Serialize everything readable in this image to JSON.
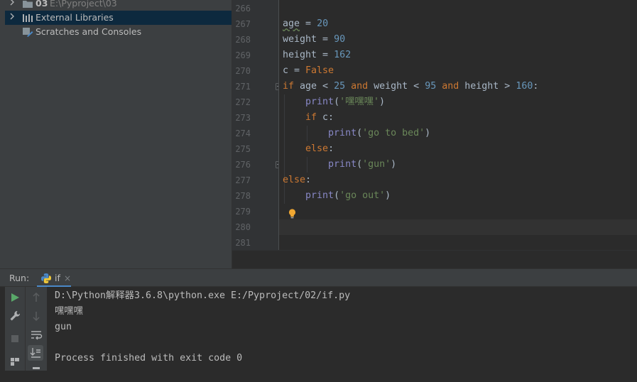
{
  "project_tree": {
    "items": [
      {
        "name": "03",
        "path": "E:\\Pyproject\\03"
      },
      {
        "label": "External Libraries"
      },
      {
        "label": "Scratches and Consoles"
      }
    ]
  },
  "editor": {
    "line_numbers": [
      "266",
      "267",
      "268",
      "269",
      "270",
      "271",
      "272",
      "273",
      "274",
      "275",
      "276",
      "277",
      "278",
      "279",
      "280",
      "281"
    ],
    "lines": [
      [],
      [
        {
          "t": "age",
          "c": "var wavy"
        },
        {
          "t": " = ",
          "c": ""
        },
        {
          "t": "20",
          "c": "num"
        }
      ],
      [
        {
          "t": "weight = ",
          "c": ""
        },
        {
          "t": "90",
          "c": "num"
        }
      ],
      [
        {
          "t": "height = ",
          "c": ""
        },
        {
          "t": "162",
          "c": "num"
        }
      ],
      [
        {
          "t": "c = ",
          "c": ""
        },
        {
          "t": "False",
          "c": "kw"
        }
      ],
      [
        {
          "t": "if",
          "c": "kw"
        },
        {
          "t": " age < ",
          "c": ""
        },
        {
          "t": "25",
          "c": "num"
        },
        {
          "t": " ",
          "c": ""
        },
        {
          "t": "and",
          "c": "kw"
        },
        {
          "t": " weight < ",
          "c": ""
        },
        {
          "t": "95",
          "c": "num"
        },
        {
          "t": " ",
          "c": ""
        },
        {
          "t": "and",
          "c": "kw"
        },
        {
          "t": " height > ",
          "c": ""
        },
        {
          "t": "160",
          "c": "num"
        },
        {
          "t": ":",
          "c": ""
        }
      ],
      [
        {
          "t": "    ",
          "c": ""
        },
        {
          "t": "print",
          "c": "fn"
        },
        {
          "t": "(",
          "c": ""
        },
        {
          "t": "'嘿嘿嘿'",
          "c": "str"
        },
        {
          "t": ")",
          "c": ""
        }
      ],
      [
        {
          "t": "    ",
          "c": ""
        },
        {
          "t": "if",
          "c": "kw"
        },
        {
          "t": " c:",
          "c": ""
        }
      ],
      [
        {
          "t": "        ",
          "c": ""
        },
        {
          "t": "print",
          "c": "fn"
        },
        {
          "t": "(",
          "c": ""
        },
        {
          "t": "'go to bed'",
          "c": "str"
        },
        {
          "t": ")",
          "c": ""
        }
      ],
      [
        {
          "t": "    ",
          "c": ""
        },
        {
          "t": "else",
          "c": "kw"
        },
        {
          "t": ":",
          "c": ""
        }
      ],
      [
        {
          "t": "        ",
          "c": ""
        },
        {
          "t": "print",
          "c": "fn"
        },
        {
          "t": "(",
          "c": ""
        },
        {
          "t": "'gun'",
          "c": "str"
        },
        {
          "t": ")",
          "c": ""
        }
      ],
      [
        {
          "t": "else",
          "c": "kw"
        },
        {
          "t": ":",
          "c": ""
        }
      ],
      [
        {
          "t": "    ",
          "c": ""
        },
        {
          "t": "print",
          "c": "fn"
        },
        {
          "t": "(",
          "c": ""
        },
        {
          "t": "'go out'",
          "c": "str"
        },
        {
          "t": ")",
          "c": ""
        }
      ],
      [],
      [],
      []
    ],
    "intention_icon": "lightbulb-icon"
  },
  "run_panel": {
    "title": "Run:",
    "tab_label": "if",
    "tab_close": "×",
    "output": [
      "D:\\Python解释器3.6.8\\python.exe E:/Pyproject/02/if.py",
      "嘿嘿嘿",
      "gun",
      "",
      "Process finished with exit code 0"
    ],
    "toolbar_icons": [
      "rerun-icon",
      "settings-wrench-icon",
      "stop-icon",
      "layout-icon",
      "up-arrow-icon",
      "down-arrow-icon",
      "soft-wrap-icon",
      "scroll-to-end-icon",
      "print-icon"
    ]
  },
  "colors": {
    "panel_bg": "#3c3f41",
    "editor_bg": "#2b2b2b",
    "selection": "#0d293e",
    "keyword": "#cc7832",
    "number": "#6897bb",
    "string": "#6a8759",
    "builtin": "#8888c6",
    "accent": "#4a88c7"
  }
}
